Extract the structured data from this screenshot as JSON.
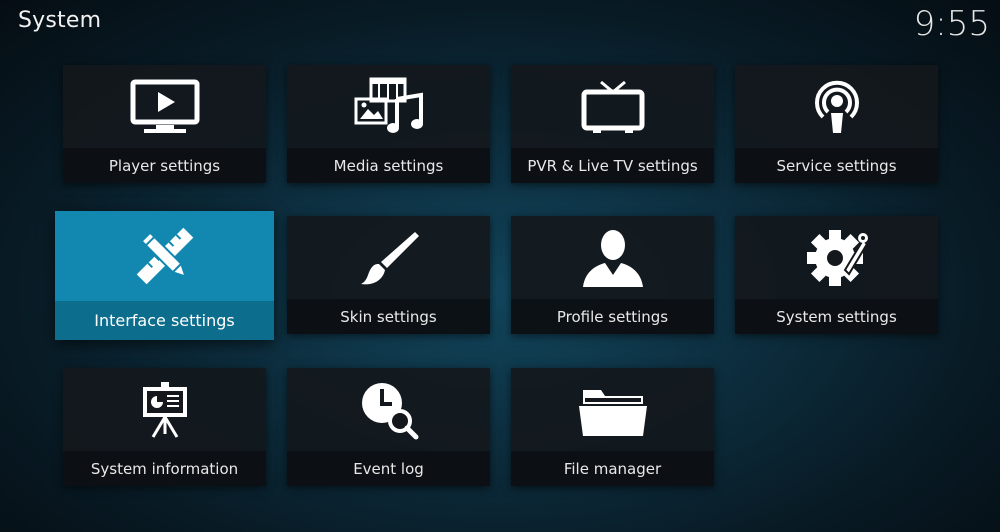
{
  "header": {
    "title": "System",
    "clock": "9:55"
  },
  "tiles": [
    {
      "label": "Player settings",
      "icon": "monitor-play-icon"
    },
    {
      "label": "Media settings",
      "icon": "media-icon"
    },
    {
      "label": "PVR & Live TV settings",
      "icon": "tv-icon"
    },
    {
      "label": "Service settings",
      "icon": "broadcast-icon"
    },
    {
      "label": "Interface settings",
      "icon": "pencil-ruler-icon",
      "focused": true
    },
    {
      "label": "Skin settings",
      "icon": "paintbrush-icon"
    },
    {
      "label": "Profile settings",
      "icon": "user-icon"
    },
    {
      "label": "System settings",
      "icon": "gear-wrench-icon"
    },
    {
      "label": "System information",
      "icon": "presentation-icon"
    },
    {
      "label": "Event log",
      "icon": "clock-search-icon"
    },
    {
      "label": "File manager",
      "icon": "folder-icon"
    }
  ],
  "colors": {
    "focus": "#1288b0",
    "focus_label": "#0c6d8d",
    "tile": "#14181c"
  }
}
